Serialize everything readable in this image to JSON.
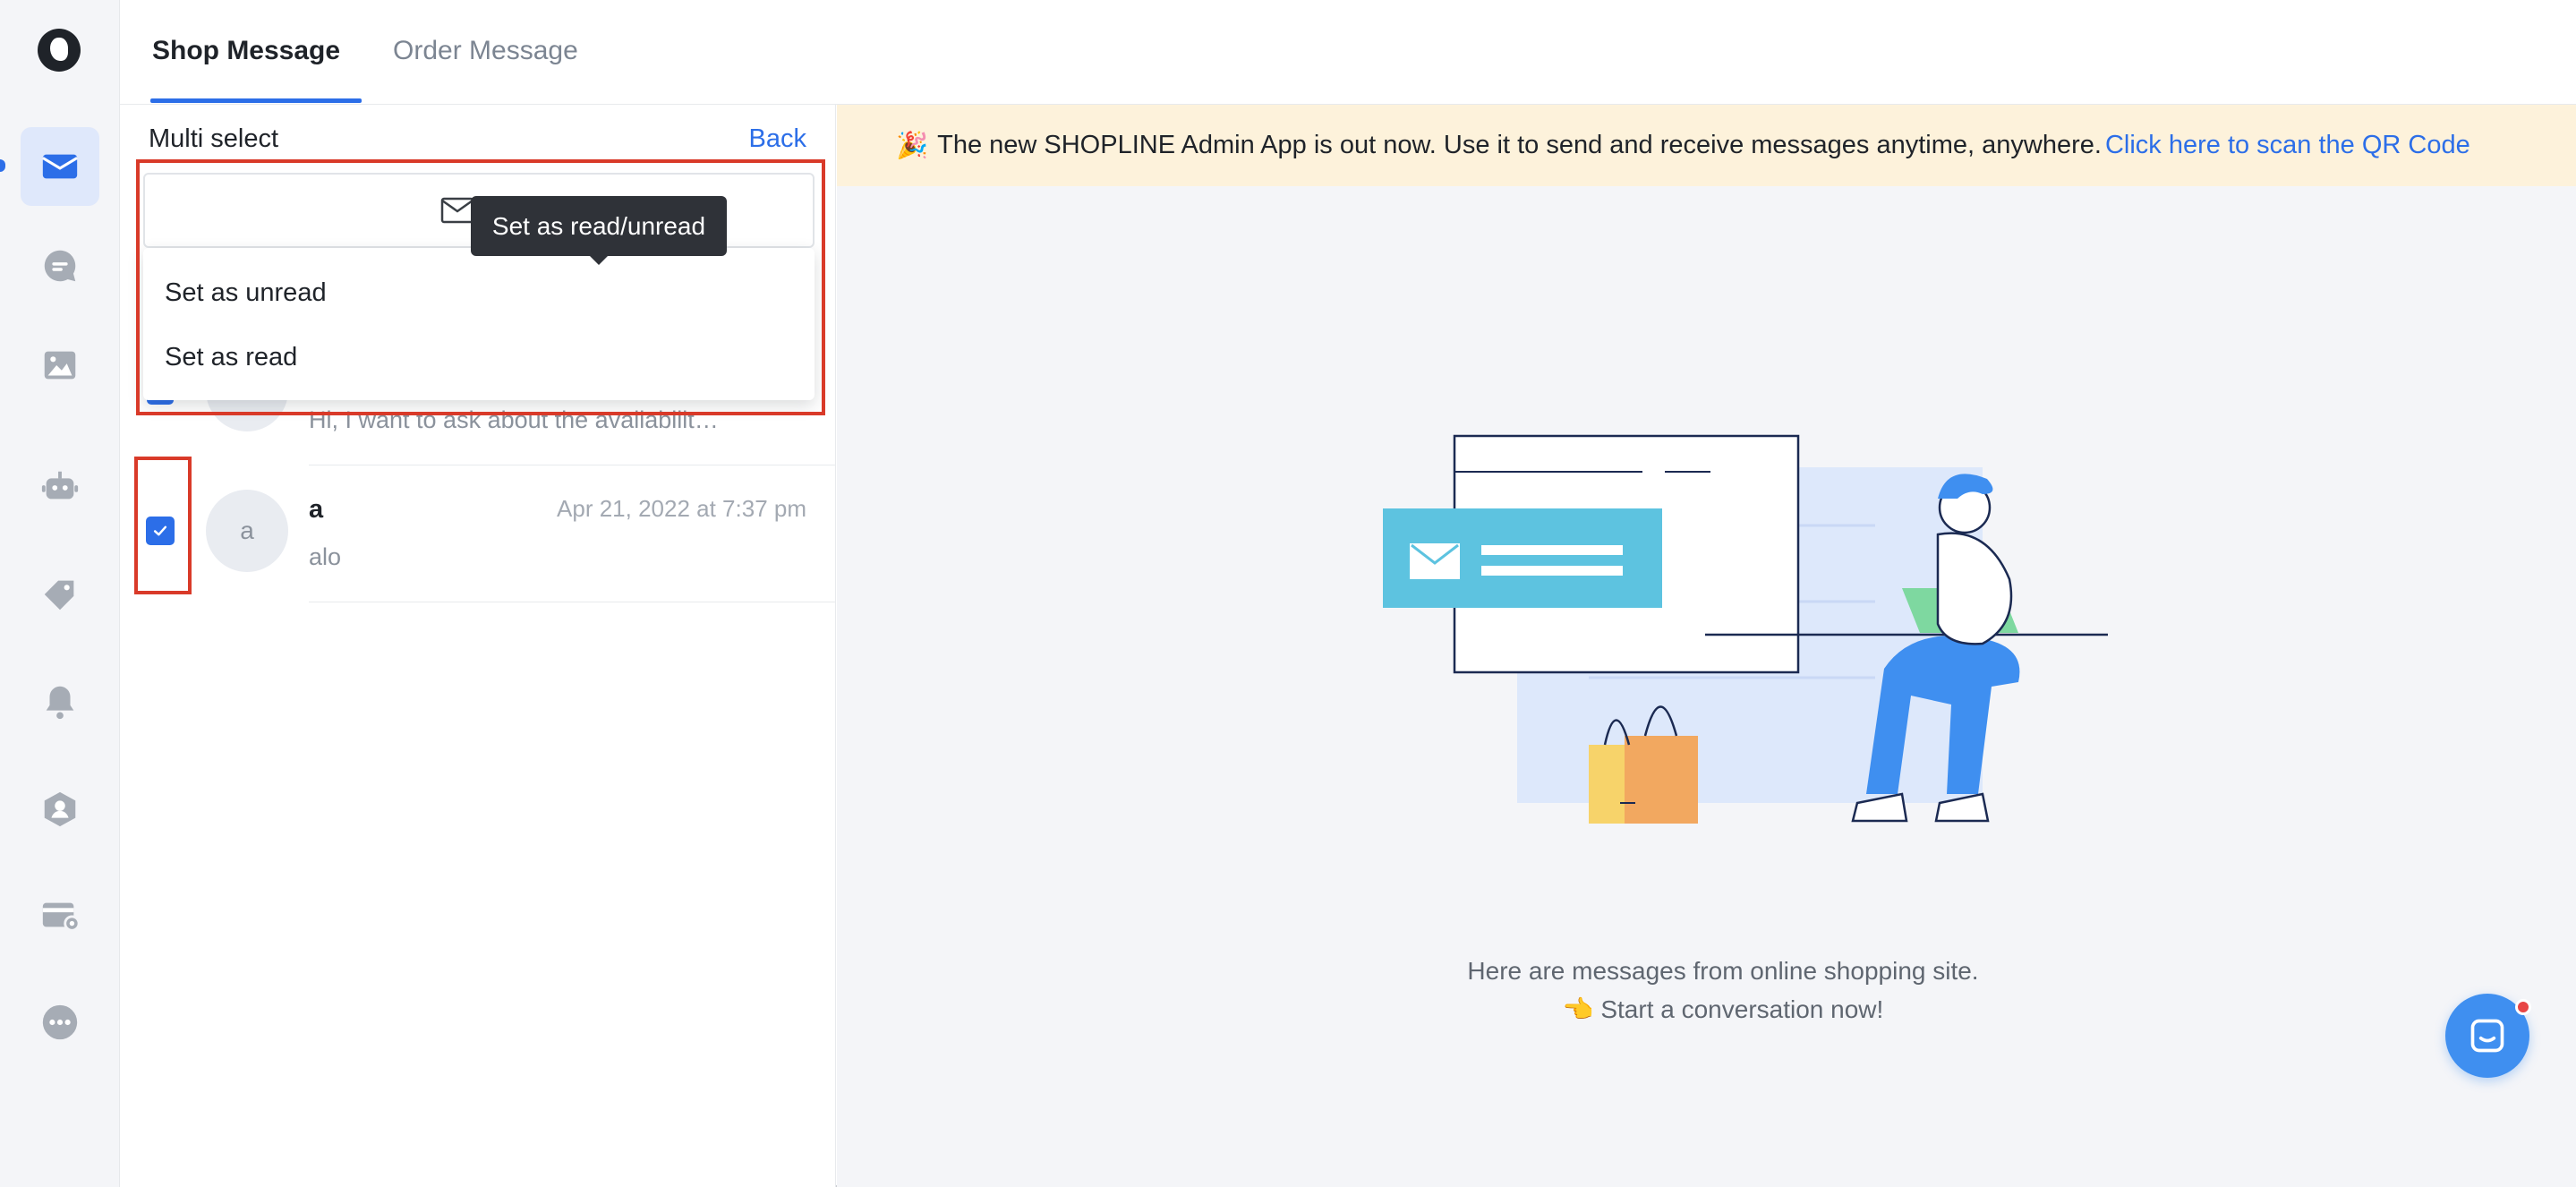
{
  "tabs": {
    "shop_message": "Shop Message",
    "order_message": "Order Message"
  },
  "sidebar": {
    "items": [
      {
        "icon": "mail-icon",
        "active": true
      },
      {
        "icon": "chat-bubble-icon"
      },
      {
        "icon": "image-icon"
      },
      {
        "icon": "robot-icon"
      },
      {
        "icon": "tag-icon"
      },
      {
        "icon": "bell-icon"
      },
      {
        "icon": "user-shield-icon"
      },
      {
        "icon": "card-settings-icon"
      },
      {
        "icon": "more-icon"
      }
    ]
  },
  "list": {
    "multi_select_label": "Multi select",
    "back_label": "Back",
    "tooltip": "Set as read/unread",
    "dropdown": {
      "set_unread": "Set as unread",
      "set_read": "Set as read"
    },
    "rows": [
      {
        "preview": "Hi, I want to ask about the availabilit…",
        "checked": true
      },
      {
        "avatar_letter": "a",
        "name": "a",
        "time": "Apr 21, 2022 at 7:37 pm",
        "preview": "alo",
        "checked": true
      }
    ]
  },
  "banner": {
    "emoji": "🎉",
    "text": "The new SHOPLINE Admin App is out now. Use it to send and receive messages anytime, anywhere.",
    "link": "Click here to scan the QR Code"
  },
  "empty_state": {
    "line1": "Here are messages from online shopping site.",
    "line2_emoji": "👈",
    "line2": "Start a conversation now!"
  },
  "colors": {
    "accent": "#2c6ee8",
    "highlight_red": "#d93a29",
    "banner_bg": "#fdf2db"
  }
}
